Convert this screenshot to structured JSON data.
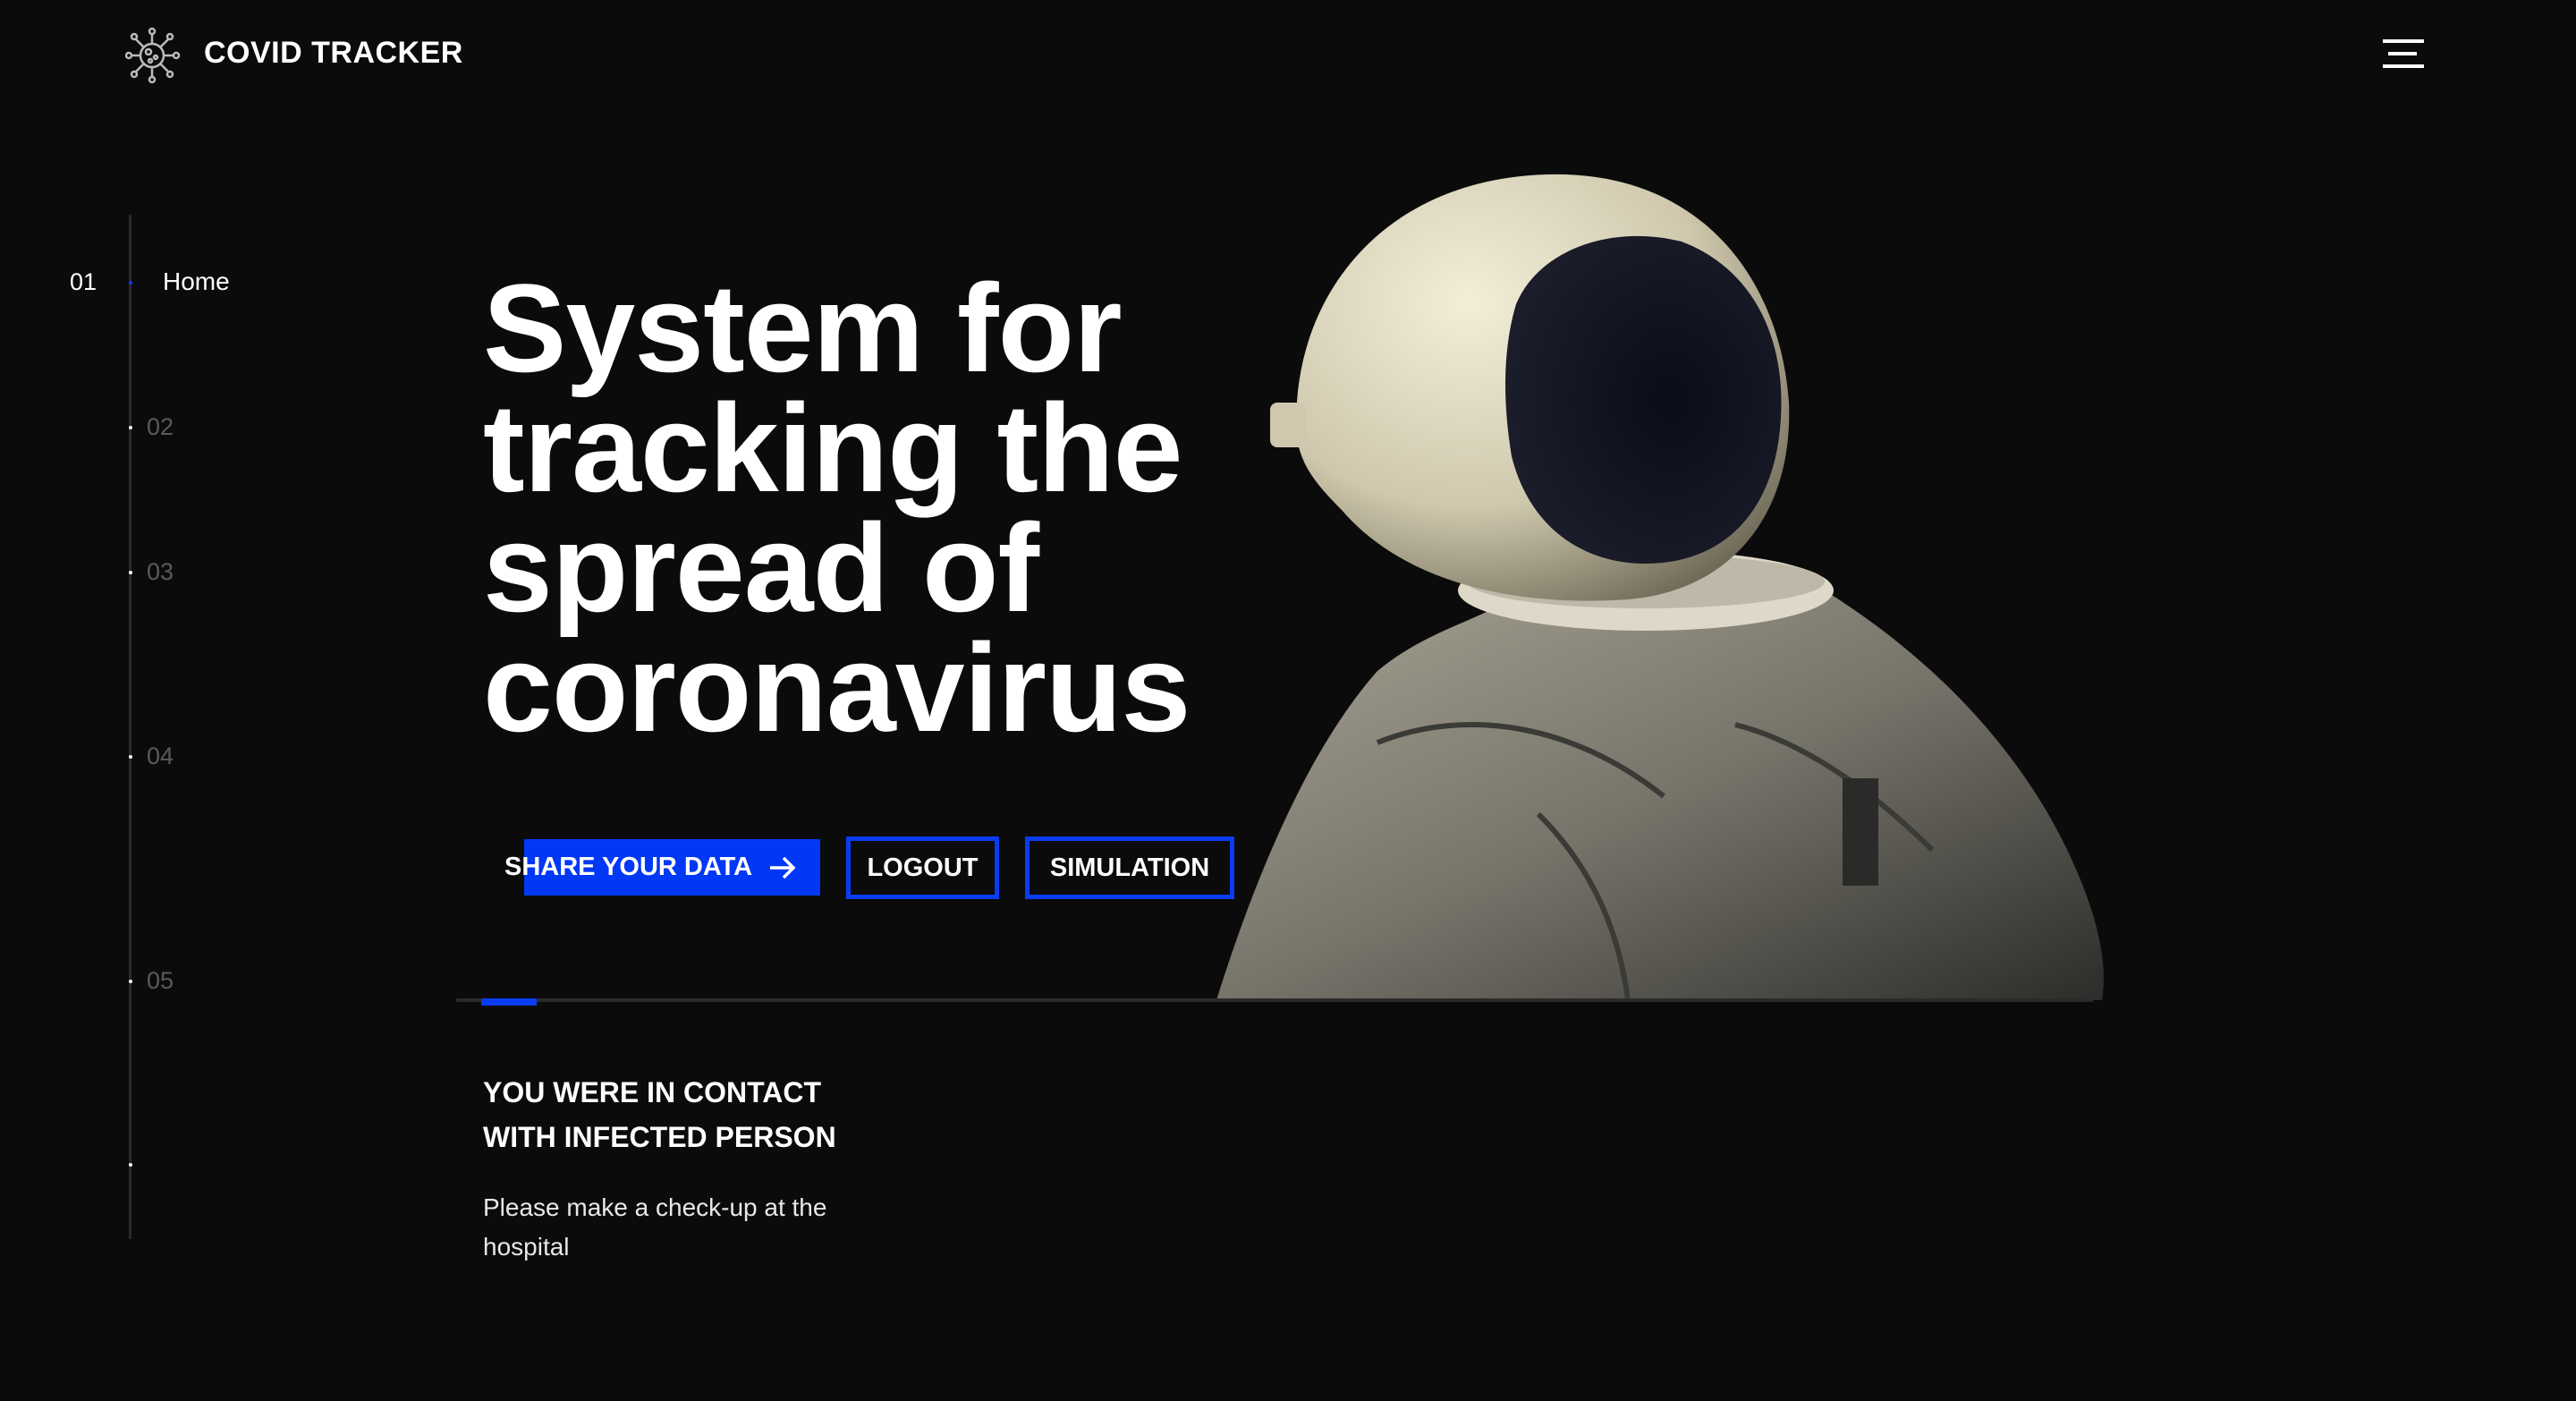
{
  "header": {
    "brand": "COVID TRACKER",
    "logo_icon": "virus-icon",
    "menu_icon": "hamburger-icon"
  },
  "sidebar": {
    "items": [
      {
        "number": "01",
        "label": "Home",
        "active": true
      },
      {
        "number": "02",
        "active": false
      },
      {
        "number": "03",
        "active": false
      },
      {
        "number": "04",
        "active": false
      },
      {
        "number": "05",
        "active": false
      }
    ]
  },
  "hero": {
    "title_lines": [
      "System for",
      "tracking the",
      "spread of",
      "coronavirus"
    ],
    "buttons": {
      "share": "SHARE YOUR DATA",
      "share_icon": "arrow-right-icon",
      "logout": "LOGOUT",
      "simulation": "SIMULATION"
    }
  },
  "notice": {
    "title_lines": [
      "YOU WERE IN CONTACT",
      "WITH INFECTED PERSON"
    ],
    "text_lines": [
      "Please make a check-up at the",
      "hospital"
    ]
  },
  "colors": {
    "background": "#0b0b0b",
    "accent": "#0038f5",
    "text": "#ffffff"
  }
}
